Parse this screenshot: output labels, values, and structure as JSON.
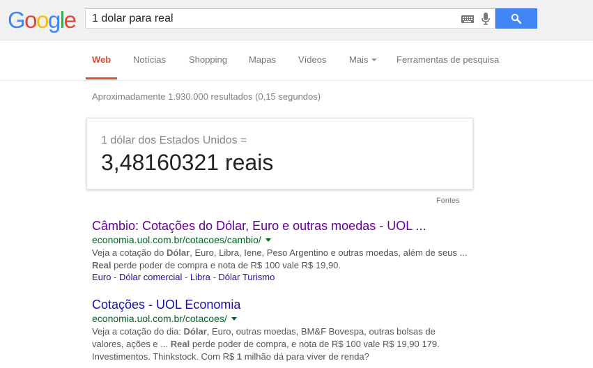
{
  "logo": {
    "letters": [
      "G",
      "o",
      "o",
      "g",
      "l",
      "e"
    ]
  },
  "search": {
    "query": "1 dolar para real"
  },
  "tabs": [
    "Web",
    "Notícias",
    "Shopping",
    "Mapas",
    "Vídeos",
    "Mais",
    "Ferramentas de pesquisa"
  ],
  "stats": "Aproximadamente 1.930.000 resultados (0,15 segundos)",
  "converter": {
    "from": "1 dólar dos Estados Unidos =",
    "to": "3,48160321 reais",
    "sources": "Fontes"
  },
  "results": [
    {
      "title": "Câmbio: Cotações do Dólar, Euro e outras moedas - UOL ...",
      "url": "economia.uol.com.br/cotacoes/cambio/",
      "snippet": [
        {
          "t": "Veja a cotação do "
        },
        {
          "t": "Dólar",
          "b": true
        },
        {
          "t": ", Euro, Libra, Iene, Peso Argentino e outras moedas, além de seus ... "
        },
        {
          "t": "Real",
          "b": true
        },
        {
          "t": " perde poder de compra e nota de R$ 100 vale R$ 19,90."
        }
      ],
      "sitelinks": [
        "Euro",
        "Dólar comercial",
        "Libra",
        "Dólar Turismo"
      ]
    },
    {
      "title": "Cotações - UOL Economia",
      "url": "economia.uol.com.br/cotacoes/",
      "snippet": [
        {
          "t": "Veja a cotação do dia: "
        },
        {
          "t": "Dólar",
          "b": true
        },
        {
          "t": ", Euro, outras moedas, BM&F Bovespa, outras bolsas de valores, ações e ... "
        },
        {
          "t": "Real",
          "b": true
        },
        {
          "t": " perde poder de compra, e nota de R$ 100 vale R$ 19,90 179. Investimentos. Thinkstock. Com R$ "
        },
        {
          "t": "1",
          "b": true
        },
        {
          "t": " milhão dá para viver de renda?"
        }
      ],
      "sitelinks": []
    }
  ],
  "colors": {
    "logo": [
      "#4285f4",
      "#ea4335",
      "#fbbc05",
      "#4285f4",
      "#34a853",
      "#ea4335"
    ],
    "active_tab": "#dd4b39",
    "visited_title": "#660099",
    "link": "#1a0dab",
    "url": "#006621",
    "search_button": "#4285f4"
  }
}
